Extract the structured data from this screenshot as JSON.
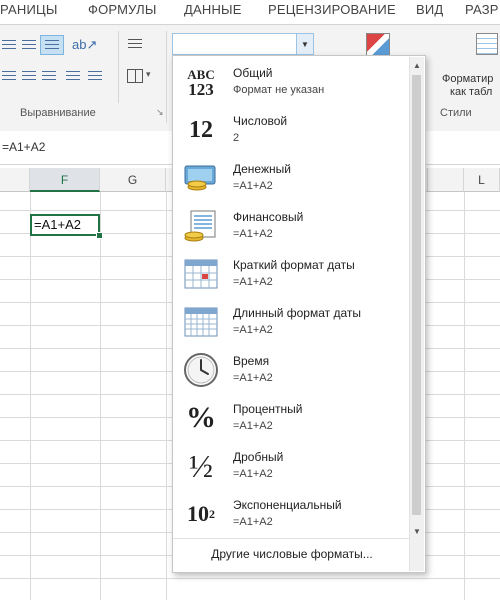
{
  "ribbon_tabs": [
    "РАНИЦЫ",
    "ФОРМУЛЫ",
    "ДАННЫЕ",
    "РЕЦЕНЗИРОВАНИЕ",
    "ВИД",
    "РАЗР"
  ],
  "ribbon": {
    "alignment_group_label": "Выравнивание",
    "styles_group_label": "Стили",
    "format_table_label_1": "Форматир",
    "format_table_label_2": "как табл"
  },
  "formula_bar": {
    "text": "=A1+A2"
  },
  "columns": {
    "f": "F",
    "g": "G",
    "l": "L"
  },
  "active_cell": {
    "value": "=A1+A2"
  },
  "number_format_combo": {
    "value": ""
  },
  "number_formats": [
    {
      "icon": "general-format-icon",
      "icon_text_1": "ABC",
      "icon_text_2": "123",
      "title": "Общий",
      "subtitle": "Формат не указан"
    },
    {
      "icon": "number-format-icon",
      "icon_text_1": "12",
      "title": "Числовой",
      "subtitle": "2"
    },
    {
      "icon": "currency-format-icon",
      "title": "Денежный",
      "subtitle": "=A1+A2"
    },
    {
      "icon": "accounting-format-icon",
      "title": "Финансовый",
      "subtitle": "=A1+A2"
    },
    {
      "icon": "short-date-calendar-icon",
      "title": "Краткий формат даты",
      "subtitle": "=A1+A2"
    },
    {
      "icon": "long-date-calendar-icon",
      "title": "Длинный формат даты",
      "subtitle": "=A1+A2"
    },
    {
      "icon": "clock-icon",
      "title": "Время",
      "subtitle": "=A1+A2"
    },
    {
      "icon": "percent-icon",
      "icon_text_1": "%",
      "title": "Процентный",
      "subtitle": "=A1+A2"
    },
    {
      "icon": "fraction-icon",
      "icon_text_1": "½",
      "title": "Дробный",
      "subtitle": "=A1+A2"
    },
    {
      "icon": "scientific-icon",
      "icon_text_1": "10",
      "icon_text_2": "2",
      "title": "Экспоненциальный",
      "subtitle": "=A1+A2"
    }
  ],
  "more_formats_label": "Другие числовые форматы...",
  "colors": {
    "excel_green": "#217346",
    "dropdown_border": "#c6c6c6",
    "combo_border": "#9cc2e4"
  }
}
